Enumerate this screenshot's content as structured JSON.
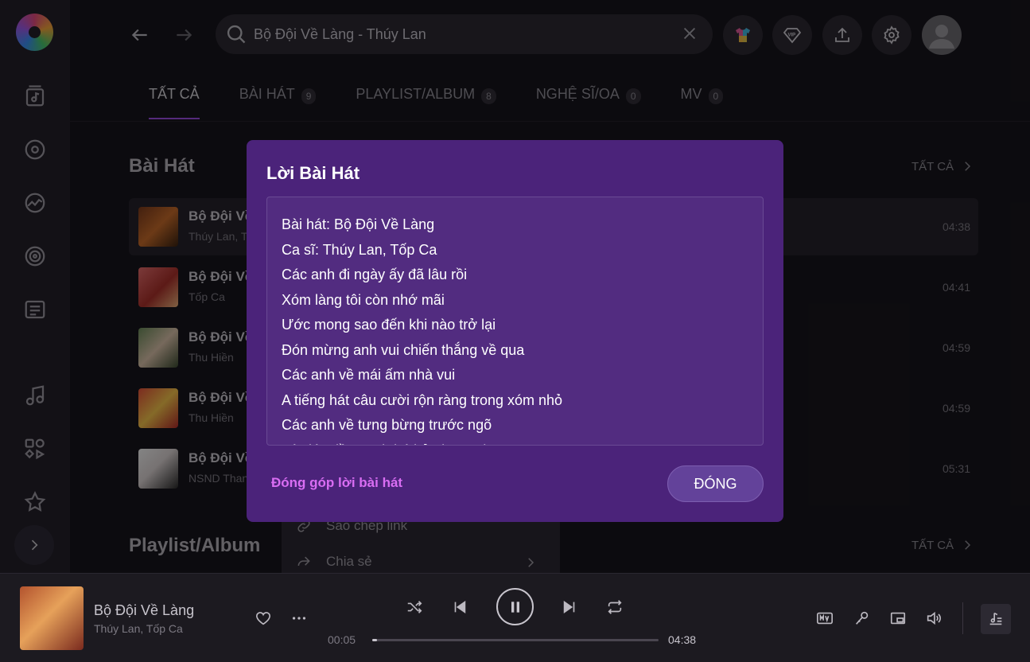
{
  "header": {
    "search_value": "Bộ Đội Về Làng - Thúy Lan"
  },
  "tabs": [
    {
      "label": "TẤT CẢ",
      "count": ""
    },
    {
      "label": "BÀI HÁT",
      "count": "9"
    },
    {
      "label": "PLAYLIST/ALBUM",
      "count": "8"
    },
    {
      "label": "NGHỆ SĨ/OA",
      "count": "0"
    },
    {
      "label": "MV",
      "count": "0"
    }
  ],
  "songs_section": {
    "title": "Bài Hát",
    "all_label": "TẤT CẢ",
    "songs": [
      {
        "name": "Bộ Đội Về Làng",
        "artist": "Thúy Lan, Tốp Ca",
        "duration": "04:38"
      },
      {
        "name": "Bộ Đội Về Làng",
        "artist": "Tốp Ca",
        "duration": "04:41"
      },
      {
        "name": "Bộ Đội Về Làng",
        "artist": "Thu Hiền",
        "duration": "04:59"
      },
      {
        "name": "Bộ Đội Về Làng",
        "artist": "Thu Hiền",
        "duration": "04:59"
      },
      {
        "name": "Bộ Đội Về Làng",
        "artist": "NSND Thanh Hoa",
        "duration": "05:31"
      }
    ]
  },
  "playlist_section": {
    "title": "Playlist/Album",
    "all_label": "TẤT CẢ"
  },
  "context_menu": {
    "copy_link": "Sao chép link",
    "share": "Chia sẻ"
  },
  "lyrics_modal": {
    "title": "Lời Bài Hát",
    "lines": [
      "Bài hát: Bộ Đội Về Làng",
      "Ca sĩ: Thúy Lan, Tốp Ca",
      "Các anh đi ngày ấy đã lâu rồi",
      "Xóm làng tôi còn nhớ mãi",
      "Ước mong sao đến khi nào trở lại",
      "Đón mừng anh vui chiến thắng về qua",
      "Các anh về mái ấm nhà vui",
      "A tiếng hát câu cười rộn ràng trong xóm nhỏ",
      "Các anh về tưng bừng trước ngõ",
      "Lúc lúc đầu xanh bá bảo hưng thương"
    ],
    "contribute_label": "Đóng góp lời bài hát",
    "close_label": "ĐÓNG"
  },
  "player": {
    "title": "Bộ Đội Về Làng",
    "artist": "Thúy Lan, Tốp Ca",
    "current_time": "00:05",
    "total_time": "04:38",
    "progress": 0.018
  },
  "colors": {
    "modal_bg": "#4b237a",
    "accent": "#9b4de0",
    "contribute_link": "#d96df3"
  }
}
